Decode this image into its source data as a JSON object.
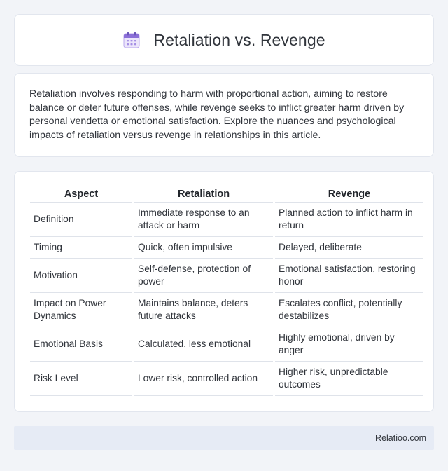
{
  "header": {
    "title": "Retaliation vs. Revenge",
    "icon": "calendar-icon",
    "icon_color": "#8b6fd8"
  },
  "intro": {
    "text": "Retaliation involves responding to harm with proportional action, aiming to restore balance or deter future offenses, while revenge seeks to inflict greater harm driven by personal vendetta or emotional satisfaction. Explore the nuances and psychological impacts of retaliation versus revenge in relationships in this article."
  },
  "table": {
    "headers": [
      "Aspect",
      "Retaliation",
      "Revenge"
    ],
    "rows": [
      [
        "Definition",
        "Immediate response to an attack or harm",
        "Planned action to inflict harm in return"
      ],
      [
        "Timing",
        "Quick, often impulsive",
        "Delayed, deliberate"
      ],
      [
        "Motivation",
        "Self-defense, protection of power",
        "Emotional satisfaction, restoring honor"
      ],
      [
        "Impact on Power Dynamics",
        "Maintains balance, deters future attacks",
        "Escalates conflict, potentially destabilizes"
      ],
      [
        "Emotional Basis",
        "Calculated, less emotional",
        "Highly emotional, driven by anger"
      ],
      [
        "Risk Level",
        "Lower risk, controlled action",
        "Higher risk, unpredictable outcomes"
      ]
    ]
  },
  "footer": {
    "site": "Relatioo.com"
  }
}
